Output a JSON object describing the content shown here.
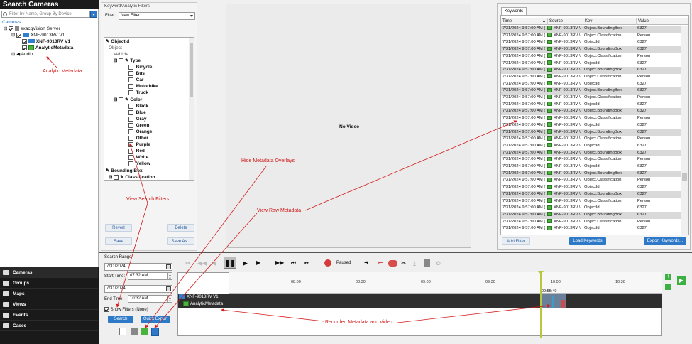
{
  "left_panel": {
    "title": "Search Cameras",
    "search_placeholder": "Filter by Name, Group By Device",
    "tree": {
      "root": "Cameras",
      "server": "exacqVision Server",
      "camera": "XNF-9013RV V1",
      "camera_sub": "XNF-9013RV V1",
      "metadata": "AnalyticMetadata",
      "audio": "Audio"
    }
  },
  "nav": {
    "items": [
      "Cameras",
      "Groups",
      "Maps",
      "Views",
      "Events",
      "Cases"
    ]
  },
  "filters_panel": {
    "title": "Keyword/Analytic Filters",
    "filter_label": "Filter:",
    "filter_value": "New Filter...",
    "tree": {
      "objectid": "ObjectId",
      "object": "Object",
      "vehicle": "Vehicle",
      "type": "Type",
      "types": [
        "Bicycle",
        "Bus",
        "Car",
        "Motorbike",
        "Truck"
      ],
      "color": "Color",
      "colors": [
        "Black",
        "Blue",
        "Gray",
        "Green",
        "Orange",
        "Other",
        "Purple",
        "Red",
        "White",
        "Yellow"
      ],
      "bounding_box": "Bounding Box",
      "classification": "Classification"
    },
    "buttons": {
      "revert": "Revert",
      "delete": "Delete",
      "save": "Save",
      "save_as": "Save As..."
    }
  },
  "video": {
    "no_video": "No Video"
  },
  "keywords": {
    "tab": "Keywords",
    "columns": [
      "Time",
      "Source",
      "Key",
      "Value"
    ],
    "time_value": "7/31/2024 9:57:00 AM (",
    "source_value": "XNF-9013RV \\",
    "rows": [
      [
        "Object.BoundingBox",
        "6327"
      ],
      [
        "Object.Classification",
        "Person"
      ],
      [
        "ObjectId",
        "6327"
      ],
      [
        "Object.BoundingBox",
        "6327"
      ],
      [
        "Object.Classification",
        "Person"
      ],
      [
        "ObjectId",
        "6327"
      ],
      [
        "Object.BoundingBox",
        "6327"
      ],
      [
        "Object.Classification",
        "Person"
      ],
      [
        "ObjectId",
        "6327"
      ],
      [
        "Object.BoundingBox",
        "6327"
      ],
      [
        "Object.Classification",
        "Person"
      ],
      [
        "ObjectId",
        "6327"
      ],
      [
        "Object.BoundingBox",
        "6327"
      ],
      [
        "Object.Classification",
        "Person"
      ],
      [
        "ObjectId",
        "6327"
      ],
      [
        "Object.BoundingBox",
        "6327"
      ],
      [
        "Object.Classification",
        "Person"
      ],
      [
        "ObjectId",
        "6327"
      ],
      [
        "Object.BoundingBox",
        "6327"
      ],
      [
        "Object.Classification",
        "Person"
      ],
      [
        "ObjectId",
        "6327"
      ],
      [
        "Object.BoundingBox",
        "6327"
      ],
      [
        "Object.Classification",
        "Person"
      ],
      [
        "ObjectId",
        "6327"
      ],
      [
        "Object.BoundingBox",
        "6327"
      ],
      [
        "Object.Classification",
        "Person"
      ],
      [
        "ObjectId",
        "6327"
      ],
      [
        "Object.BoundingBox",
        "6327"
      ],
      [
        "Object.Classification",
        "Person"
      ],
      [
        "ObjectId",
        "6327"
      ]
    ],
    "add_filter": "Add Filter",
    "load_keywords": "Load Keywords",
    "export_keywords": "Export Keywords..."
  },
  "search_range": {
    "title": "Search Range",
    "start_date": "7/31/2024",
    "start_time_label": "Start Time:",
    "start_time": "07:32 AM",
    "end_date": "7/31/2024",
    "end_time_label": "End Time:",
    "end_time": "10:32 AM",
    "show_filters": "Show Filters (None)",
    "search_btn": "Search",
    "quick_export_btn": "Quick Export"
  },
  "playback": {
    "status": "Paused"
  },
  "timeline": {
    "ticks": [
      "08:00",
      "08:30",
      "09:00",
      "09:30",
      "10:00",
      "10:30"
    ],
    "cursor_time": "09:55:40",
    "track_camera": "XNF-9013RV V1",
    "track_metadata": "AnalyticMetadata"
  },
  "annotations": {
    "analytic_metadata": "Analytic Metadata",
    "view_search_filters": "View Search Filters",
    "hide_overlays": "Hide Metadata Overlays",
    "view_raw": "View Raw Metadata",
    "recorded": "Recorded Metadata and Video"
  },
  "colors": {
    "accent": "#2d79c7",
    "annotation": "#d21b1b",
    "metadata_green": "#49b33d",
    "dark_nav": "#1a1a1a"
  }
}
